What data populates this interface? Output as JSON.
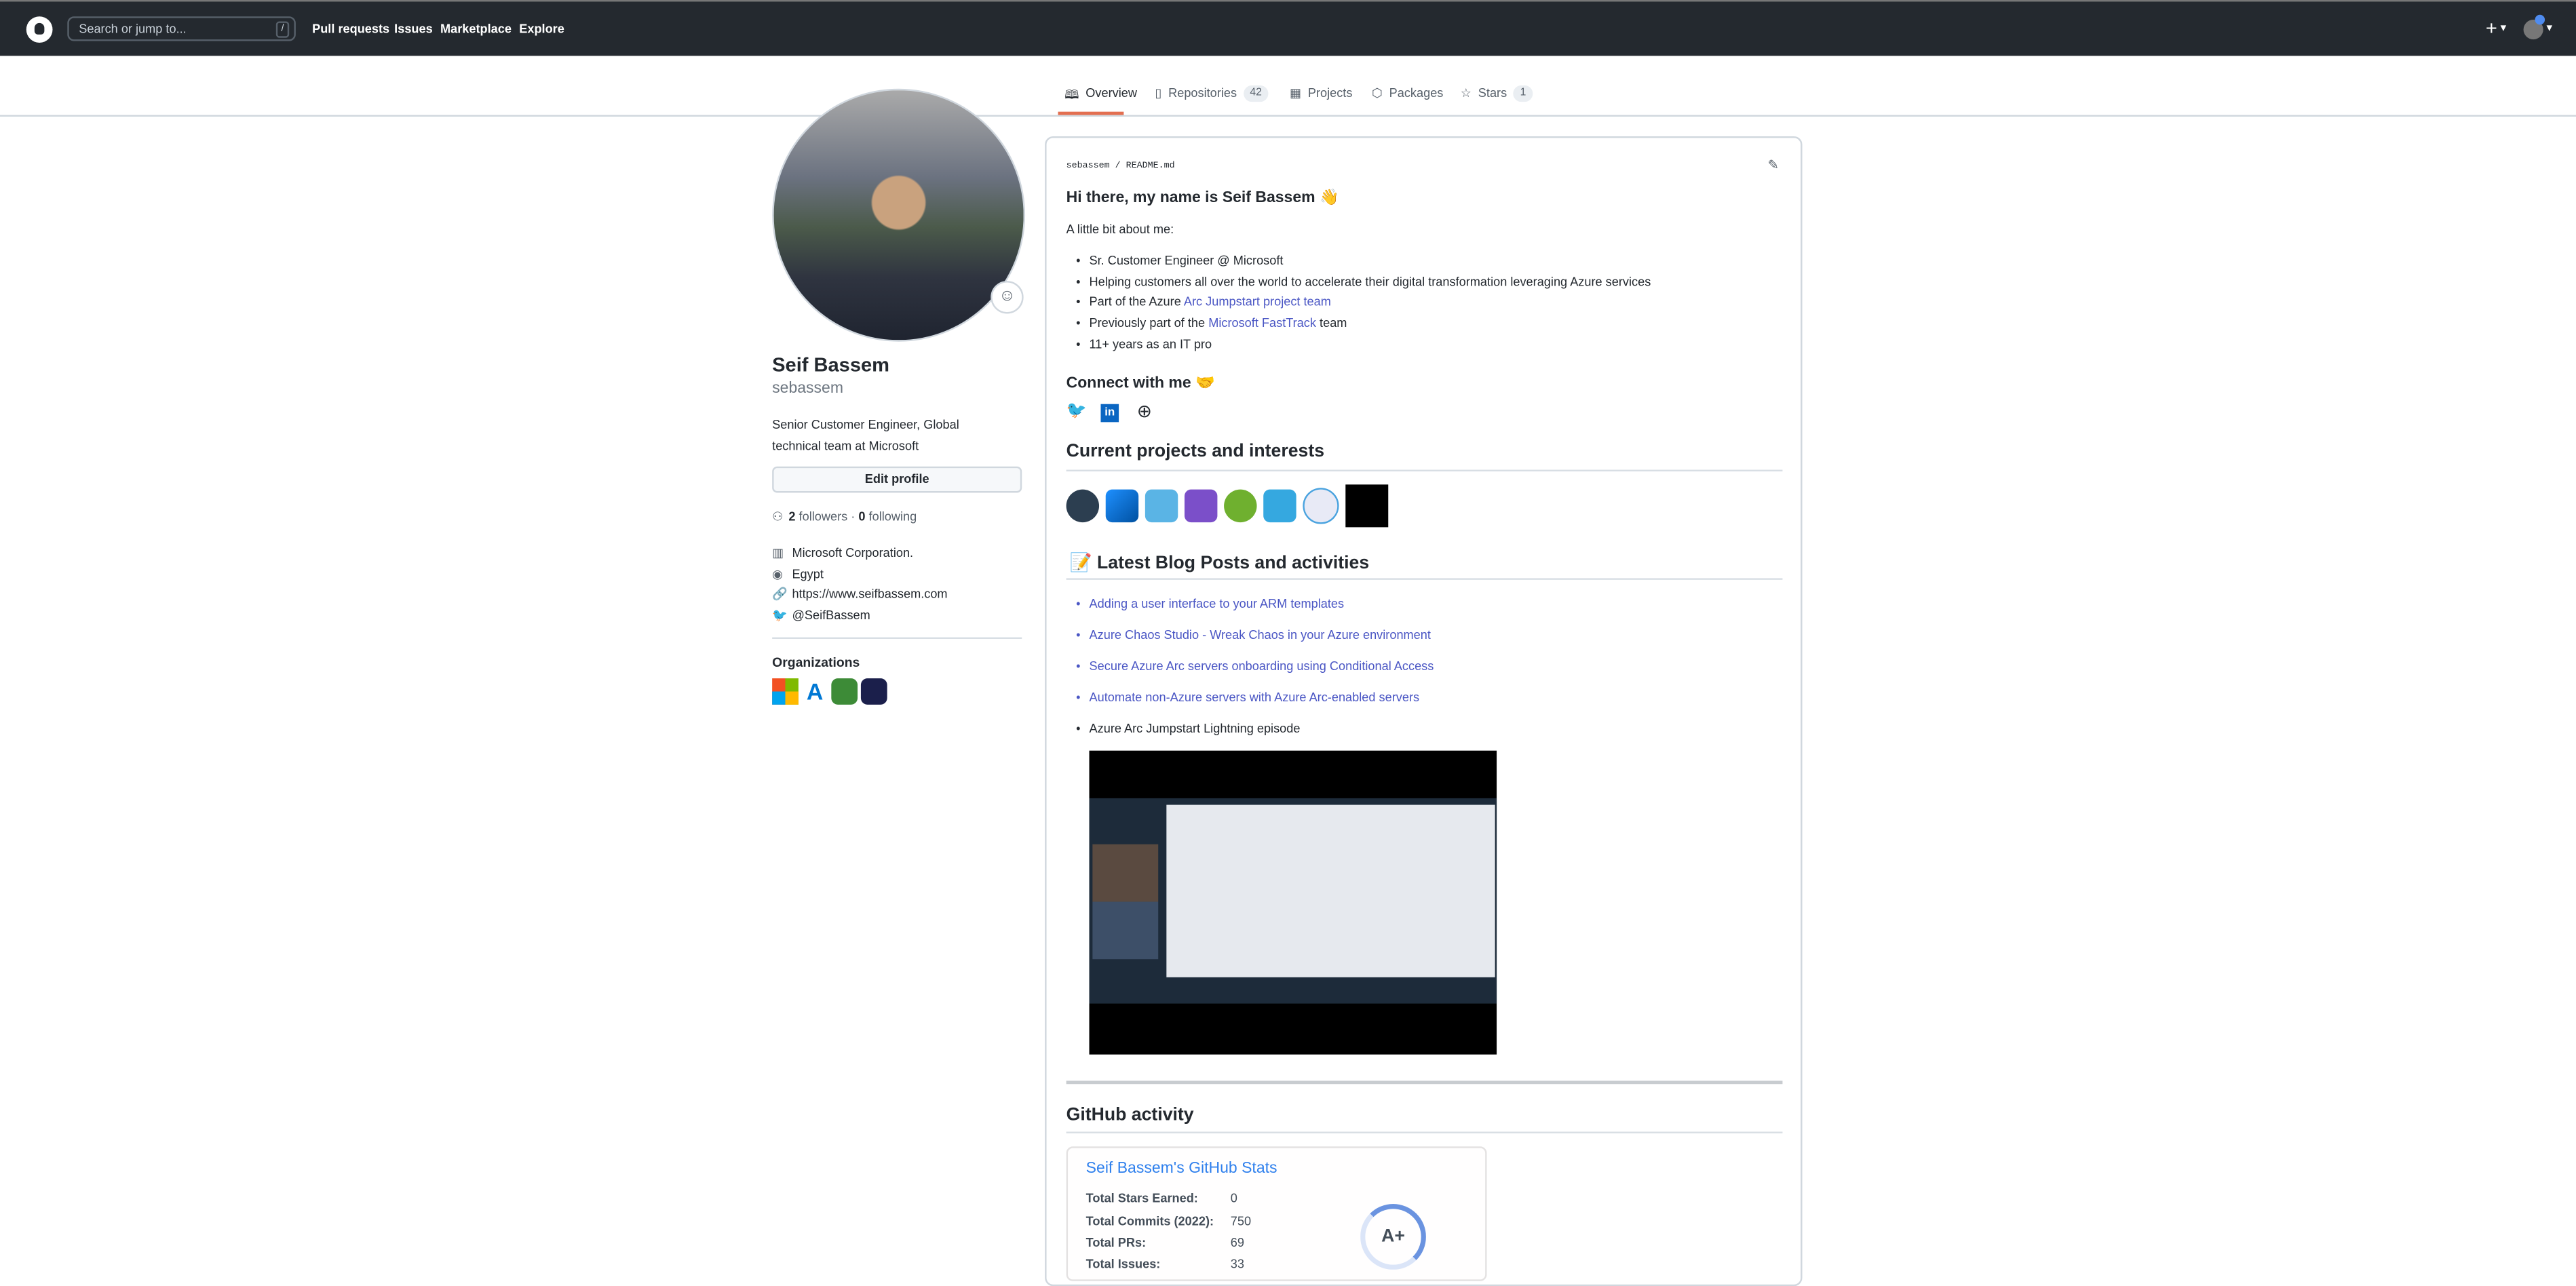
{
  "header": {
    "search_placeholder": "Search or jump to...",
    "slash_key": "/",
    "nav": [
      "Pull requests",
      "Issues",
      "Marketplace",
      "Explore"
    ],
    "plus": "+",
    "caret": "▾"
  },
  "tabs": [
    {
      "label": "Overview",
      "icon": "book-icon"
    },
    {
      "label": "Repositories",
      "count": "42",
      "icon": "repo-icon"
    },
    {
      "label": "Projects",
      "icon": "table-icon"
    },
    {
      "label": "Packages",
      "icon": "package-icon"
    },
    {
      "label": "Stars",
      "count": "1",
      "icon": "star-icon"
    }
  ],
  "profile": {
    "name": "Seif Bassem",
    "username": "sebassem",
    "bio": "Senior Customer Engineer, Global technical team at Microsoft",
    "edit_button": "Edit profile",
    "followers_count": "2",
    "followers_label": "followers",
    "sep": "·",
    "following_count": "0",
    "following_label": "following",
    "company": "Microsoft Corporation.",
    "location": "Egypt",
    "website": "https://www.seifbassem.com",
    "twitter": "@SeifBassem",
    "orgs_heading": "Organizations"
  },
  "readme": {
    "path_user": "sebassem",
    "path_sep": "/",
    "path_file": "README.md",
    "greeting": "Hi there, my name is Seif Bassem 👋",
    "intro": "A little bit about me:",
    "about": [
      {
        "text": "Sr. Customer Engineer @ Microsoft"
      },
      {
        "text": "Helping customers all over the world to accelerate their digital transformation leveraging Azure services"
      },
      {
        "text": "Part of the Azure ",
        "link": "Arc Jumpstart project team"
      },
      {
        "text": "Previously part of the ",
        "link": "Microsoft FastTrack",
        "after": " team"
      },
      {
        "text": "11+ years as an IT pro"
      }
    ],
    "connect": "Connect with me 🤝",
    "projects_heading": "Current projects and interests",
    "blog_heading": "📝 Latest Blog Posts and activities",
    "posts": [
      "Adding a user interface to your ARM templates",
      "Azure Chaos Studio - Wreak Chaos in your Azure environment",
      "Secure Azure Arc servers onboarding using Conditional Access",
      "Automate non-Azure servers with Azure Arc-enabled servers"
    ],
    "episode": "Azure Arc Jumpstart Lightning episode",
    "activity_heading": "GitHub activity"
  },
  "stats": {
    "title": "Seif Bassem's GitHub Stats",
    "rows": [
      {
        "label": "Total Stars Earned:",
        "value": "0"
      },
      {
        "label": "Total Commits (2022):",
        "value": "750"
      },
      {
        "label": "Total PRs:",
        "value": "69"
      },
      {
        "label": "Total Issues:",
        "value": "33"
      }
    ],
    "grade": "A+"
  }
}
